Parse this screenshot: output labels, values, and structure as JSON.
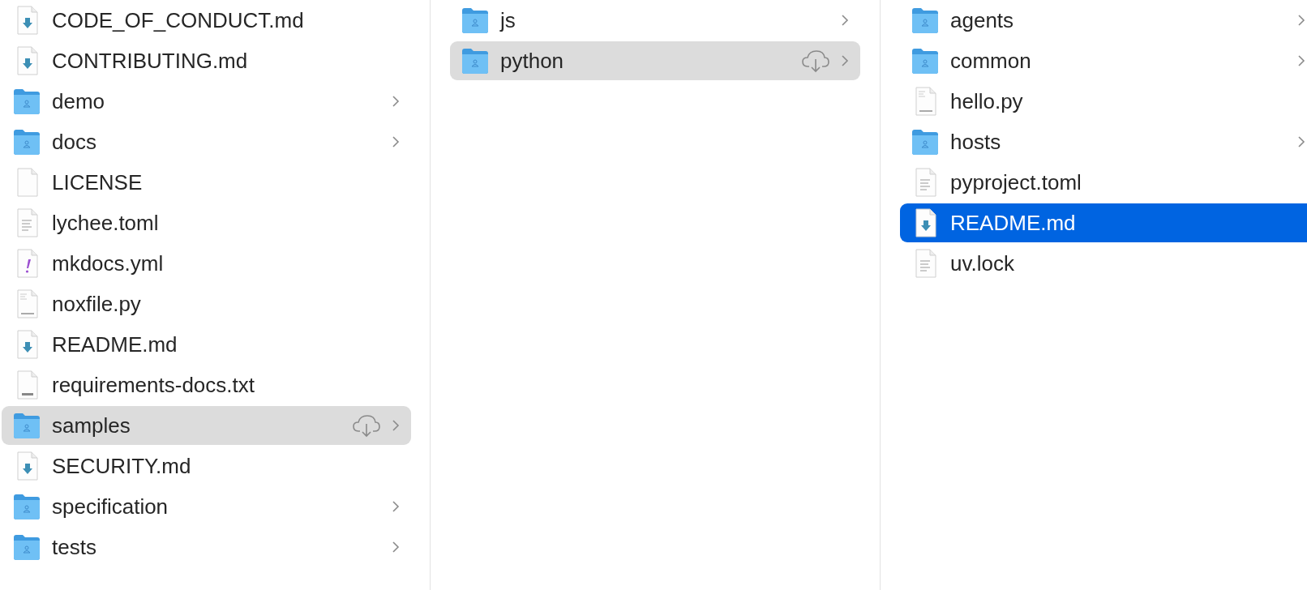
{
  "columns": [
    {
      "focused": false,
      "items": [
        {
          "name": "CODE_OF_CONDUCT.md",
          "kind": "markdown",
          "selected": false,
          "cloud": false
        },
        {
          "name": "CONTRIBUTING.md",
          "kind": "markdown",
          "selected": false,
          "cloud": false
        },
        {
          "name": "demo",
          "kind": "folder",
          "selected": false,
          "cloud": false
        },
        {
          "name": "docs",
          "kind": "folder",
          "selected": false,
          "cloud": false
        },
        {
          "name": "LICENSE",
          "kind": "blank",
          "selected": false,
          "cloud": false
        },
        {
          "name": "lychee.toml",
          "kind": "text",
          "selected": false,
          "cloud": false
        },
        {
          "name": "mkdocs.yml",
          "kind": "yaml",
          "selected": false,
          "cloud": false
        },
        {
          "name": "noxfile.py",
          "kind": "python",
          "selected": false,
          "cloud": false
        },
        {
          "name": "README.md",
          "kind": "markdown",
          "selected": false,
          "cloud": false
        },
        {
          "name": "requirements-docs.txt",
          "kind": "txt",
          "selected": false,
          "cloud": false
        },
        {
          "name": "samples",
          "kind": "folder",
          "selected": true,
          "cloud": true
        },
        {
          "name": "SECURITY.md",
          "kind": "markdown",
          "selected": false,
          "cloud": false
        },
        {
          "name": "specification",
          "kind": "folder",
          "selected": false,
          "cloud": false
        },
        {
          "name": "tests",
          "kind": "folder",
          "selected": false,
          "cloud": false
        }
      ]
    },
    {
      "focused": false,
      "items": [
        {
          "name": "js",
          "kind": "folder",
          "selected": false,
          "cloud": false
        },
        {
          "name": "python",
          "kind": "folder",
          "selected": true,
          "cloud": true
        }
      ]
    },
    {
      "focused": true,
      "items": [
        {
          "name": "agents",
          "kind": "folder",
          "selected": false,
          "cloud": false
        },
        {
          "name": "common",
          "kind": "folder",
          "selected": false,
          "cloud": false
        },
        {
          "name": "hello.py",
          "kind": "python",
          "selected": false,
          "cloud": false
        },
        {
          "name": "hosts",
          "kind": "folder",
          "selected": false,
          "cloud": false
        },
        {
          "name": "pyproject.toml",
          "kind": "text",
          "selected": false,
          "cloud": false
        },
        {
          "name": "README.md",
          "kind": "markdown",
          "selected": true,
          "cloud": false
        },
        {
          "name": "uv.lock",
          "kind": "text",
          "selected": false,
          "cloud": false
        }
      ]
    }
  ]
}
